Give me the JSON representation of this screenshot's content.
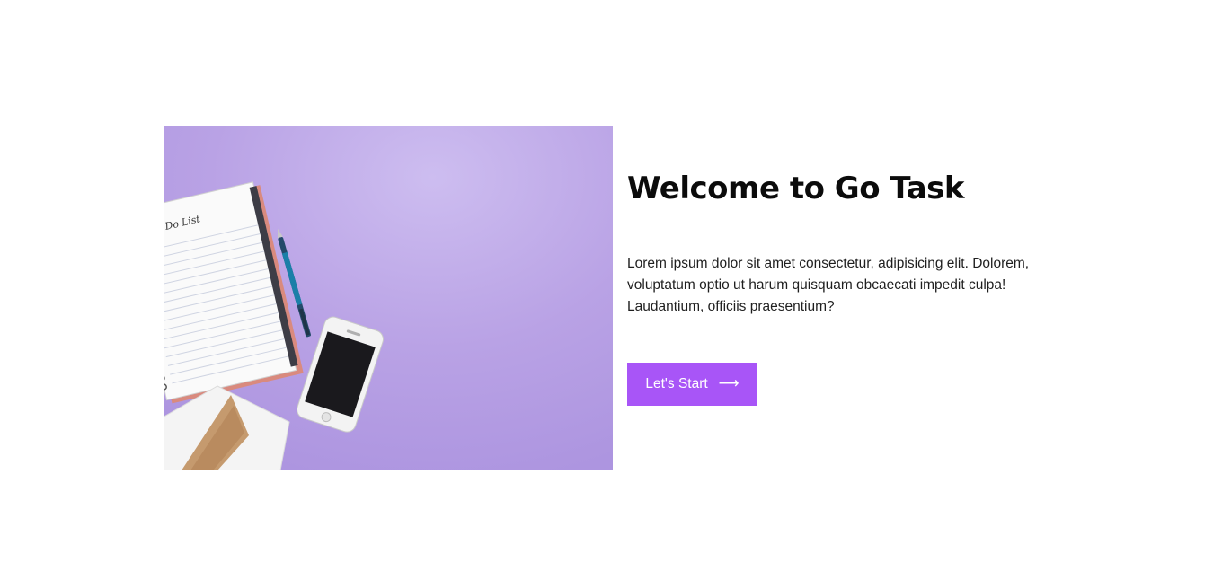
{
  "hero": {
    "image_alt": "Notebook with to-do list, pen, smartphone and envelope on purple background",
    "notebook_text": "To Do List"
  },
  "content": {
    "title": "Welcome to Go Task",
    "description": "Lorem ipsum dolor sit amet consectetur, adipisicing elit. Dolorem, voluptatum optio ut harum quisquam obcaecati impedit culpa! Laudantium, officiis praesentium?"
  },
  "cta": {
    "label": "Let's Start",
    "icon": "arrow-right-icon",
    "color": "#a855f7"
  },
  "colors": {
    "hero_background": "#b9a3e6",
    "title": "#0b0b0b"
  }
}
